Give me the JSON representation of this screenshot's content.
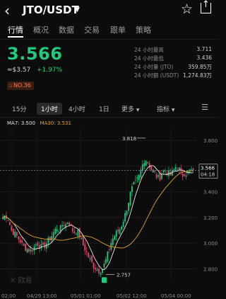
{
  "header": {
    "back_icon": "chevron-left-icon",
    "pair": "JTO/USDT",
    "dropdown_icon": "caret-down-icon",
    "favorite_icon": "star-outline-icon",
    "share_icon": "share-icon"
  },
  "tabs": [
    "行情",
    "概况",
    "数据",
    "交易",
    "跟单",
    "策略"
  ],
  "active_tab": "行情",
  "ticker": {
    "last_price": "3.566",
    "fiat_price": "≈$3.57",
    "change_pct": "+1.97%",
    "rank_badge": "NO.36"
  },
  "stats": [
    {
      "label": "24 小时最高",
      "value": "3.711"
    },
    {
      "label": "24 小时最低",
      "value": "3.436"
    },
    {
      "label": "24 小时量 (JTO)",
      "value": "359.85万"
    },
    {
      "label": "24 小时额 (USDT)",
      "value": "1,274.83万"
    }
  ],
  "intervals": {
    "items": [
      "15分",
      "1小时",
      "4小时",
      "1日"
    ],
    "active": "1小时",
    "more_label": "更多",
    "indicator_label": "指标",
    "settings_icon": "chart-settings-icon"
  },
  "ma_legend": {
    "ma7": "MA7: 3.500",
    "ma30": "MA30: 3.531"
  },
  "chart": {
    "price_tag": "3.566",
    "countdown": "04:18",
    "high_label": "3.818",
    "low_label": "2.757",
    "watermark": "欧易"
  },
  "colors": {
    "up": "#21c97d",
    "down": "#e0476a",
    "ma7": "#e6e6e6",
    "ma30": "#e0a32a",
    "background": "#0c0c0c"
  },
  "chart_data": {
    "type": "candlestick",
    "title": "",
    "y_axis_ticks": [
      "3.800",
      "3.600",
      "3.400",
      "3.200",
      "3.000",
      "2.800"
    ],
    "x_axis_ticks": [
      "02:00",
      "04/29 13:00",
      "05/01 01:00",
      "05/02 12:00",
      "05/04 00:00"
    ],
    "ylim": [
      2.72,
      3.9
    ],
    "annotated_high": 3.818,
    "annotated_low": 2.757,
    "last_price": 3.566,
    "close_path": [
      3.2,
      3.22,
      3.18,
      3.1,
      3.08,
      3.05,
      3.02,
      2.98,
      2.96,
      2.95,
      2.94,
      2.97,
      3.0,
      2.98,
      2.96,
      2.99,
      3.02,
      3.05,
      3.09,
      3.12,
      3.1,
      3.15,
      3.14,
      3.18,
      3.12,
      3.08,
      3.1,
      3.06,
      3.0,
      2.95,
      2.9,
      2.86,
      2.82,
      2.8,
      2.78,
      2.8,
      2.85,
      2.92,
      3.0,
      3.05,
      3.08,
      3.1,
      3.15,
      3.22,
      3.3,
      3.4,
      3.45,
      3.48,
      3.52,
      3.6,
      3.66,
      3.63,
      3.58,
      3.56,
      3.52,
      3.5,
      3.55,
      3.57,
      3.55,
      3.53,
      3.56,
      3.6,
      3.58,
      3.52,
      3.55,
      3.54,
      3.57,
      3.566
    ]
  }
}
